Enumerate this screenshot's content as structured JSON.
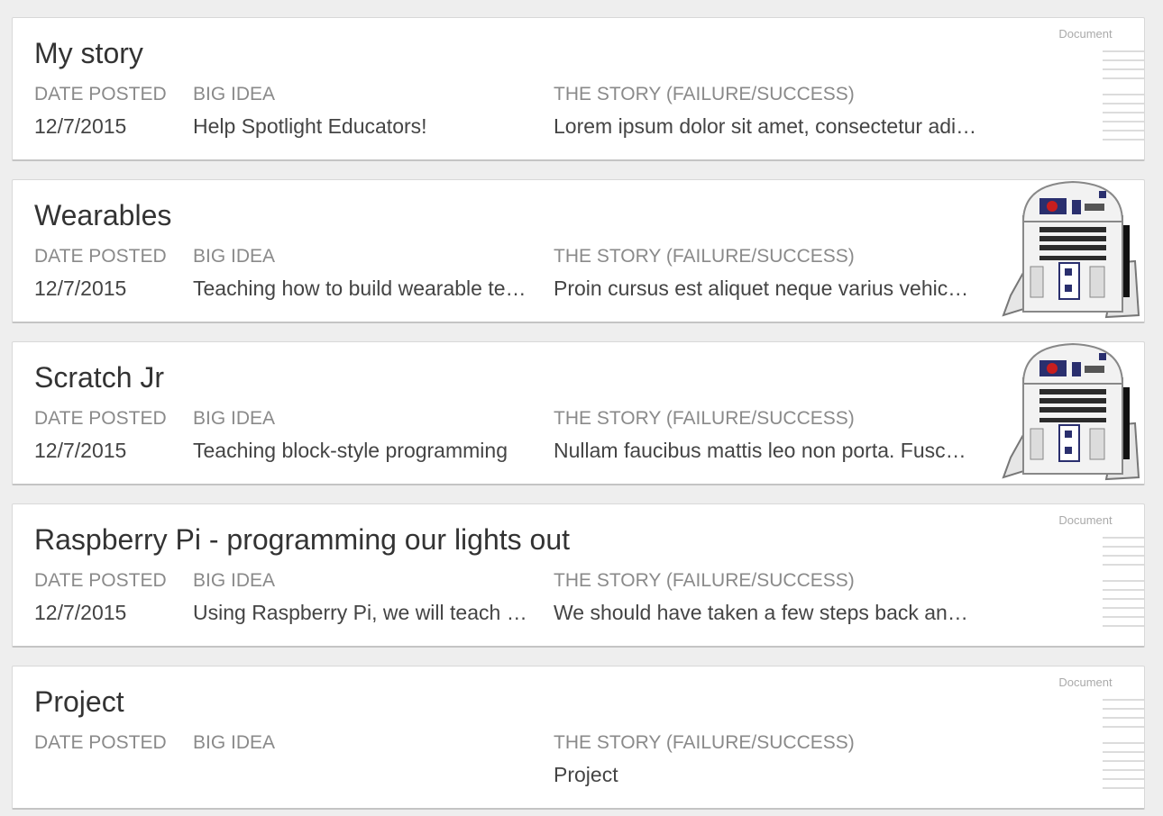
{
  "labels": {
    "date_posted": "DATE POSTED",
    "big_idea": "BIG IDEA",
    "the_story": "THE STORY (FAILURE/SUCCESS)"
  },
  "thumbnail_text": {
    "document": "Document"
  },
  "stories": [
    {
      "title": "My story",
      "date": "12/7/2015",
      "big_idea": "Help Spotlight Educators!",
      "story": "Lorem ipsum dolor sit amet, consectetur adipiscing elit.",
      "thumbnail": "document"
    },
    {
      "title": "Wearables",
      "date": "12/7/2015",
      "big_idea": "Teaching how to build wearable technology",
      "story": "Proin cursus est aliquet neque varius vehicula.",
      "thumbnail": "robot-image"
    },
    {
      "title": "Scratch Jr",
      "date": "12/7/2015",
      "big_idea": "Teaching block-style programming",
      "story": "Nullam faucibus mattis leo non porta. Fusce vitae.",
      "thumbnail": "robot-image"
    },
    {
      "title": "Raspberry Pi - programming our lights out",
      "date": "12/7/2015",
      "big_idea": "Using Raspberry Pi, we will teach programming",
      "story": "We should have taken a few steps back and planned.",
      "thumbnail": "document"
    },
    {
      "title": "Project",
      "date": "",
      "big_idea": "",
      "story": "Project",
      "thumbnail": "document"
    }
  ]
}
